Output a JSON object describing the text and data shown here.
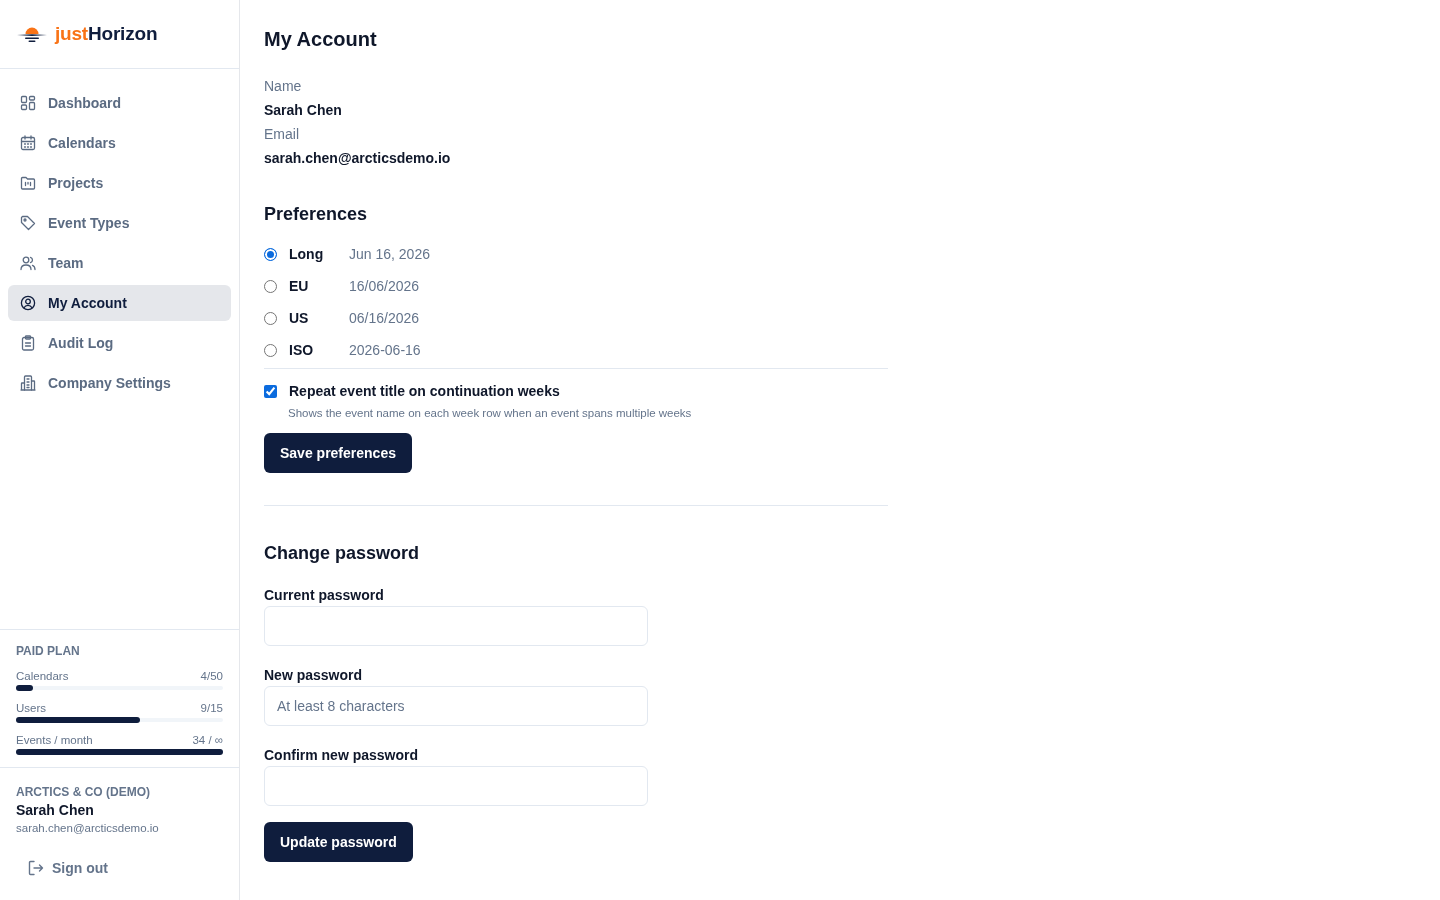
{
  "sidebar": {
    "logo": {
      "prefix": "just",
      "name": "Horizon"
    },
    "nav": [
      {
        "kind": "dashboard",
        "label": "Dashboard",
        "selected": false
      },
      {
        "kind": "calendar",
        "label": "Calendars",
        "selected": false
      },
      {
        "kind": "folder",
        "label": "Projects",
        "selected": false
      },
      {
        "kind": "tag",
        "label": "Event Types",
        "selected": false
      },
      {
        "kind": "team",
        "label": "Team",
        "selected": false
      },
      {
        "kind": "account",
        "label": "My Account",
        "selected": true
      },
      {
        "kind": "clipboard",
        "label": "Audit Log",
        "selected": false
      },
      {
        "kind": "building",
        "label": "Company Settings",
        "selected": false
      }
    ],
    "plan": {
      "title": "PAID PLAN",
      "meters": [
        {
          "label": "Calendars",
          "reading": "4/50",
          "level": 0.08
        },
        {
          "label": "Users",
          "reading": "9/15",
          "level": 0.6
        },
        {
          "label": "Events / month",
          "reading": "34 / ∞",
          "level": 1
        }
      ]
    },
    "account": {
      "org": "ARCTICS & CO (DEMO)",
      "name": "Sarah Chen",
      "email": "sarah.chen@arcticsdemo.io"
    },
    "sign_out": "Sign out"
  },
  "main": {
    "title": "My Account",
    "profile": [
      {
        "label": "Name",
        "value": "Sarah Chen"
      },
      {
        "label": "Email",
        "value": "sarah.chen@arcticsdemo.io"
      }
    ],
    "preferences": {
      "heading": "Preferences",
      "date_formats": [
        {
          "label": "Long",
          "example": "Jun 16, 2026",
          "selected": true
        },
        {
          "label": "EU",
          "example": "16/06/2026",
          "selected": false
        },
        {
          "label": "US",
          "example": "06/16/2026",
          "selected": false
        },
        {
          "label": "ISO",
          "example": "2026-06-16",
          "selected": false
        }
      ],
      "repeat_title": {
        "label": "Repeat event title on continuation weeks",
        "hint": "Shows the event name on each week row when an event spans multiple weeks",
        "checked": true
      },
      "save_button": "Save preferences"
    },
    "change_password": {
      "heading": "Change password",
      "fields": [
        {
          "label": "Current password"
        },
        {
          "label": "New password",
          "placeholder": "At least 8 characters"
        },
        {
          "label": "Confirm new password"
        }
      ],
      "submit_button": "Update password"
    }
  }
}
